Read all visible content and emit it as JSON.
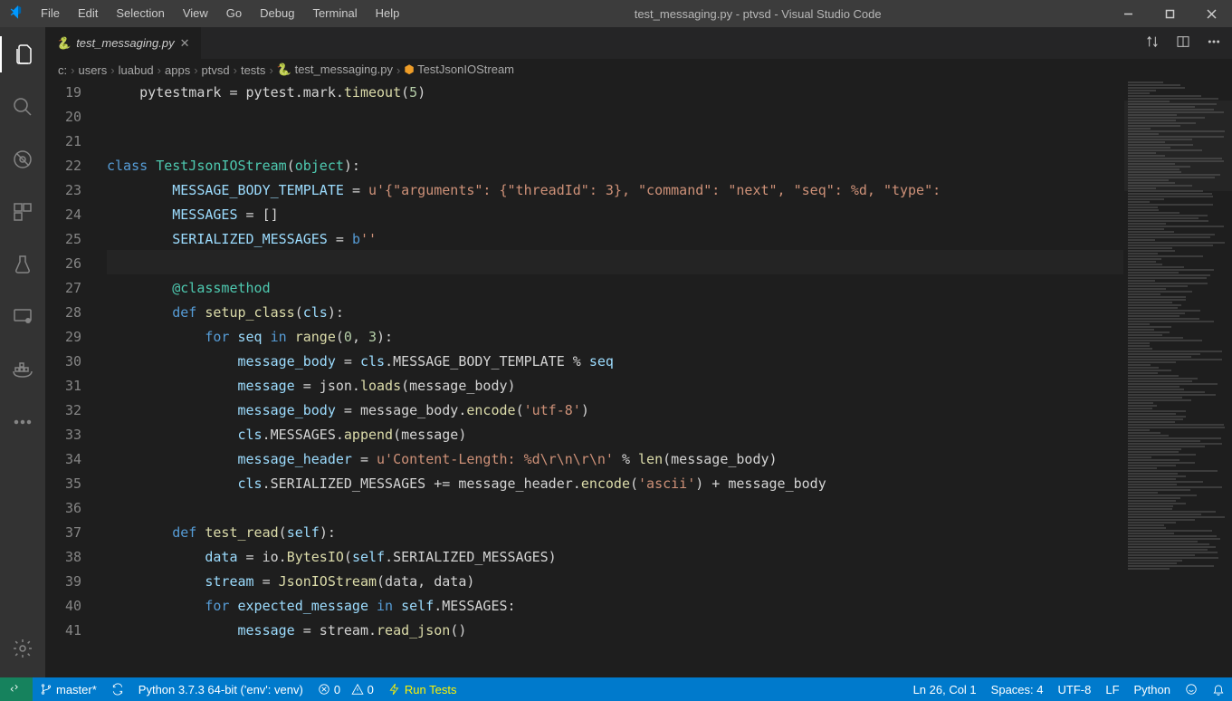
{
  "title": "test_messaging.py - ptvsd - Visual Studio Code",
  "menu": [
    "File",
    "Edit",
    "Selection",
    "View",
    "Go",
    "Debug",
    "Terminal",
    "Help"
  ],
  "tab": {
    "name": "test_messaging.py"
  },
  "breadcrumbs": [
    "c:",
    "users",
    "luabud",
    "apps",
    "ptvsd",
    "tests",
    "test_messaging.py",
    "TestJsonIOStream"
  ],
  "code_lines": [
    {
      "n": 19,
      "seg": [
        [
          "    pytestmark ",
          "d"
        ],
        [
          "=",
          "d"
        ],
        [
          " pytest",
          "d"
        ],
        [
          ".",
          "d"
        ],
        [
          "mark",
          "d"
        ],
        [
          ".",
          "d"
        ],
        [
          "timeout",
          "fn"
        ],
        [
          "(",
          "d"
        ],
        [
          "5",
          "num"
        ],
        [
          ")",
          "d"
        ]
      ]
    },
    {
      "n": 20,
      "seg": []
    },
    {
      "n": 21,
      "seg": []
    },
    {
      "n": 22,
      "seg": [
        [
          "class ",
          "kw"
        ],
        [
          "TestJsonIOStream",
          "cls"
        ],
        [
          "(",
          "d"
        ],
        [
          "object",
          "cls"
        ],
        [
          "):",
          "d"
        ]
      ]
    },
    {
      "n": 23,
      "seg": [
        [
          "        MESSAGE_BODY_TEMPLATE ",
          "prm"
        ],
        [
          "= ",
          "d"
        ],
        [
          "u'{\"arguments\": {\"threadId\": 3}, \"command\": \"next\", \"seq\": %d, \"type\":",
          "str"
        ]
      ]
    },
    {
      "n": 24,
      "seg": [
        [
          "        MESSAGES ",
          "prm"
        ],
        [
          "= []",
          "d"
        ]
      ]
    },
    {
      "n": 25,
      "seg": [
        [
          "        SERIALIZED_MESSAGES ",
          "prm"
        ],
        [
          "= ",
          "d"
        ],
        [
          "b",
          "lit"
        ],
        [
          "''",
          "str"
        ]
      ]
    },
    {
      "n": 26,
      "seg": []
    },
    {
      "n": 27,
      "seg": [
        [
          "        @",
          "deco"
        ],
        [
          "classmethod",
          "deco"
        ]
      ]
    },
    {
      "n": 28,
      "seg": [
        [
          "        ",
          "d"
        ],
        [
          "def ",
          "kw"
        ],
        [
          "setup_class",
          "fn"
        ],
        [
          "(",
          "d"
        ],
        [
          "cls",
          "prm"
        ],
        [
          "):",
          "d"
        ]
      ]
    },
    {
      "n": 29,
      "seg": [
        [
          "            ",
          "d"
        ],
        [
          "for ",
          "kw"
        ],
        [
          "seq ",
          "prm"
        ],
        [
          "in ",
          "kw"
        ],
        [
          "range",
          "fn"
        ],
        [
          "(",
          "d"
        ],
        [
          "0",
          "num"
        ],
        [
          ", ",
          "d"
        ],
        [
          "3",
          "num"
        ],
        [
          "):",
          "d"
        ]
      ]
    },
    {
      "n": 30,
      "seg": [
        [
          "                message_body ",
          "prm"
        ],
        [
          "= ",
          "d"
        ],
        [
          "cls",
          "prm"
        ],
        [
          ".MESSAGE_BODY_TEMPLATE ",
          "d"
        ],
        [
          "% ",
          "d"
        ],
        [
          "seq",
          "prm"
        ]
      ]
    },
    {
      "n": 31,
      "seg": [
        [
          "                message ",
          "prm"
        ],
        [
          "= json.",
          "d"
        ],
        [
          "loads",
          "fn"
        ],
        [
          "(message_body)",
          "d"
        ]
      ]
    },
    {
      "n": 32,
      "seg": [
        [
          "                message_body ",
          "prm"
        ],
        [
          "= message_body.",
          "d"
        ],
        [
          "encode",
          "fn"
        ],
        [
          "(",
          "d"
        ],
        [
          "'utf-8'",
          "str"
        ],
        [
          ")",
          "d"
        ]
      ]
    },
    {
      "n": 33,
      "seg": [
        [
          "                ",
          "d"
        ],
        [
          "cls",
          "prm"
        ],
        [
          ".MESSAGES.",
          "d"
        ],
        [
          "append",
          "fn"
        ],
        [
          "(message)",
          "d"
        ]
      ]
    },
    {
      "n": 34,
      "seg": [
        [
          "                message_header ",
          "prm"
        ],
        [
          "= ",
          "d"
        ],
        [
          "u'Content-Length: %d\\r\\n\\r\\n'",
          "str"
        ],
        [
          " % ",
          "d"
        ],
        [
          "len",
          "fn"
        ],
        [
          "(message_body)",
          "d"
        ]
      ]
    },
    {
      "n": 35,
      "seg": [
        [
          "                ",
          "d"
        ],
        [
          "cls",
          "prm"
        ],
        [
          ".SERIALIZED_MESSAGES ",
          "d"
        ],
        [
          "+= ",
          "d"
        ],
        [
          "message_header.",
          "d"
        ],
        [
          "encode",
          "fn"
        ],
        [
          "(",
          "d"
        ],
        [
          "'ascii'",
          "str"
        ],
        [
          ") + message_body",
          "d"
        ]
      ]
    },
    {
      "n": 36,
      "seg": []
    },
    {
      "n": 37,
      "seg": [
        [
          "        ",
          "d"
        ],
        [
          "def ",
          "kw"
        ],
        [
          "test_read",
          "fn"
        ],
        [
          "(",
          "d"
        ],
        [
          "self",
          "prm"
        ],
        [
          "):",
          "d"
        ]
      ]
    },
    {
      "n": 38,
      "seg": [
        [
          "            data ",
          "prm"
        ],
        [
          "= io.",
          "d"
        ],
        [
          "BytesIO",
          "fn"
        ],
        [
          "(",
          "d"
        ],
        [
          "self",
          "prm"
        ],
        [
          ".SERIALIZED_MESSAGES)",
          "d"
        ]
      ]
    },
    {
      "n": 39,
      "seg": [
        [
          "            stream ",
          "prm"
        ],
        [
          "= ",
          "d"
        ],
        [
          "JsonIOStream",
          "fn"
        ],
        [
          "(data, data)",
          "d"
        ]
      ]
    },
    {
      "n": 40,
      "seg": [
        [
          "            ",
          "d"
        ],
        [
          "for ",
          "kw"
        ],
        [
          "expected_message ",
          "prm"
        ],
        [
          "in ",
          "kw"
        ],
        [
          "self",
          "prm"
        ],
        [
          ".MESSAGES:",
          "d"
        ]
      ]
    },
    {
      "n": 41,
      "seg": [
        [
          "                message ",
          "prm"
        ],
        [
          "= stream.",
          "d"
        ],
        [
          "read_json",
          "fn"
        ],
        [
          "()",
          "d"
        ]
      ]
    }
  ],
  "statusbar": {
    "branch": "master*",
    "python": "Python 3.7.3 64-bit ('env': venv)",
    "errors": "0",
    "warnings": "0",
    "run_tests": "Run Tests",
    "ln_col": "Ln 26, Col 1",
    "spaces": "Spaces: 4",
    "encoding": "UTF-8",
    "eol": "LF",
    "language": "Python"
  }
}
